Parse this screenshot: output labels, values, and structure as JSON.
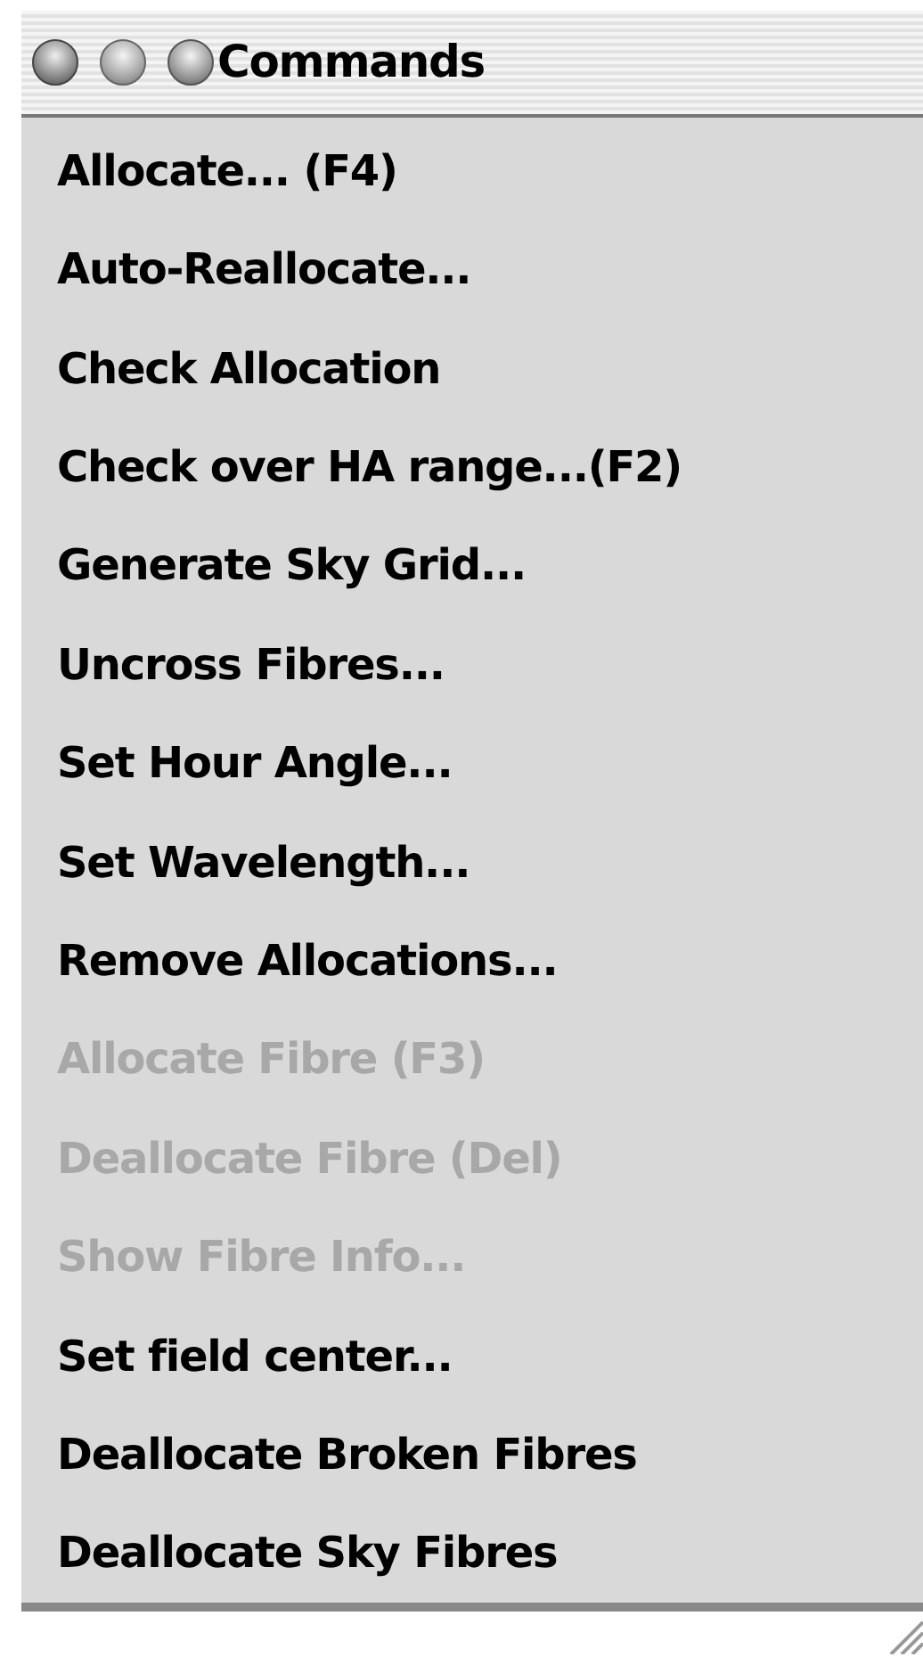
{
  "window": {
    "title": "Commands"
  },
  "menu_items": [
    {
      "label": "Allocate... (F4)",
      "disabled": false
    },
    {
      "label": "Auto-Reallocate...",
      "disabled": false
    },
    {
      "label": "Check Allocation",
      "disabled": false
    },
    {
      "label": "Check over HA range...(F2)",
      "disabled": false
    },
    {
      "label": "Generate Sky Grid...",
      "disabled": false
    },
    {
      "label": "Uncross Fibres...",
      "disabled": false
    },
    {
      "label": "Set Hour Angle...",
      "disabled": false
    },
    {
      "label": "Set Wavelength...",
      "disabled": false
    },
    {
      "label": "Remove Allocations...",
      "disabled": false
    },
    {
      "label": "Allocate Fibre (F3)",
      "disabled": true
    },
    {
      "label": "Deallocate Fibre (Del)",
      "disabled": true
    },
    {
      "label": "Show Fibre Info...",
      "disabled": true
    },
    {
      "label": "Set field center...",
      "disabled": false
    },
    {
      "label": "Deallocate Broken Fibres",
      "disabled": false
    },
    {
      "label": "Deallocate Sky Fibres",
      "disabled": false
    }
  ]
}
